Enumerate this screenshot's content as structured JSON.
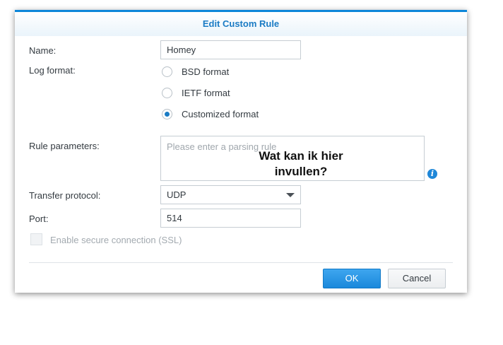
{
  "dialog": {
    "title": "Edit Custom Rule"
  },
  "form": {
    "name_label": "Name:",
    "name_value": "Homey",
    "log_format_label": "Log format:",
    "log_format_options": [
      {
        "label": "BSD format",
        "checked": false
      },
      {
        "label": "IETF format",
        "checked": false
      },
      {
        "label": "Customized format",
        "checked": true
      }
    ],
    "rule_parameters_label": "Rule parameters:",
    "rule_parameters_placeholder": "Please enter a parsing rule",
    "info_icon_glyph": "i",
    "transfer_protocol_label": "Transfer protocol:",
    "transfer_protocol_value": "UDP",
    "port_label": "Port:",
    "port_value": "514",
    "ssl_label": "Enable secure connection (SSL)",
    "ssl_checked": false,
    "ssl_disabled": true
  },
  "buttons": {
    "ok_label": "OK",
    "cancel_label": "Cancel"
  },
  "annotation": {
    "line1": "Wat kan ik hier",
    "line2": "invullen?"
  },
  "colors": {
    "accent": "#1a7bc4",
    "primary_button": "#1a88db"
  },
  "icons": {
    "info": "info-icon",
    "dropdown": "chevron-down-icon"
  }
}
